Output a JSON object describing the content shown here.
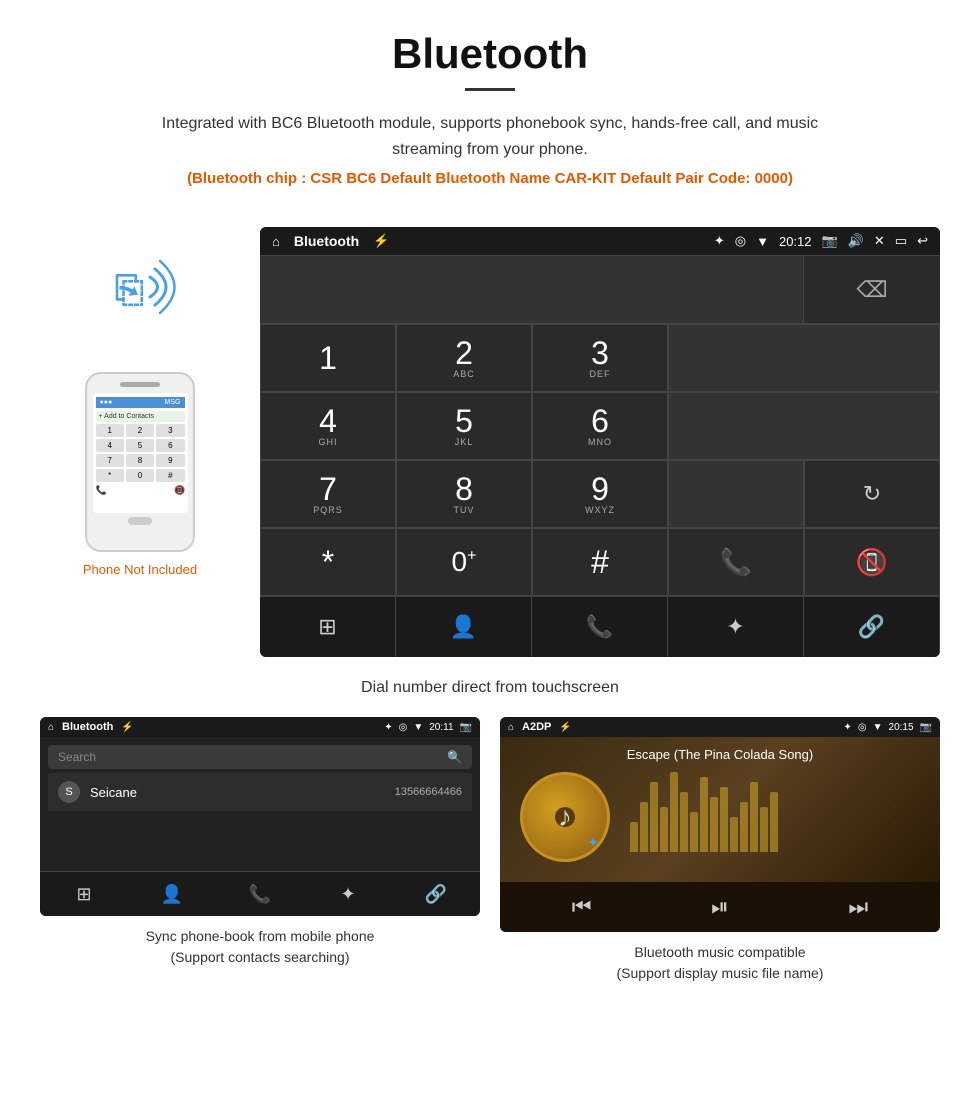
{
  "header": {
    "title": "Bluetooth",
    "description": "Integrated with BC6 Bluetooth module, supports phonebook sync, hands-free call, and music streaming from your phone.",
    "specs": "(Bluetooth chip : CSR BC6    Default Bluetooth Name CAR-KIT    Default Pair Code: 0000)"
  },
  "phone_side": {
    "not_included": "Phone Not Included",
    "screen_label": "+ Add to Contacts"
  },
  "dialer": {
    "status_title": "Bluetooth",
    "time": "20:12",
    "keys": [
      {
        "num": "1",
        "sub": ""
      },
      {
        "num": "2",
        "sub": "ABC"
      },
      {
        "num": "3",
        "sub": "DEF"
      },
      {
        "num": "4",
        "sub": "GHI"
      },
      {
        "num": "5",
        "sub": "JKL"
      },
      {
        "num": "6",
        "sub": "MNO"
      },
      {
        "num": "7",
        "sub": "PQRS"
      },
      {
        "num": "8",
        "sub": "TUV"
      },
      {
        "num": "9",
        "sub": "WXYZ"
      },
      {
        "num": "*",
        "sub": ""
      },
      {
        "num": "0",
        "sub": "+"
      },
      {
        "num": "#",
        "sub": ""
      }
    ]
  },
  "caption_main": "Dial number direct from touchscreen",
  "phonebook": {
    "status_title": "Bluetooth",
    "time": "20:11",
    "search_placeholder": "Search",
    "contact_letter": "S",
    "contact_name": "Seicane",
    "contact_number": "13566664466"
  },
  "music": {
    "status_title": "A2DP",
    "time": "20:15",
    "song_title": "Escape (The Pina Colada Song)"
  },
  "caption_phonebook": {
    "line1": "Sync phone-book from mobile phone",
    "line2": "(Support contacts searching)"
  },
  "caption_music": {
    "line1": "Bluetooth music compatible",
    "line2": "(Support display music file name)"
  },
  "eq_bars": [
    30,
    50,
    70,
    45,
    80,
    60,
    40,
    75,
    55,
    65,
    35,
    50,
    70,
    45,
    60
  ]
}
